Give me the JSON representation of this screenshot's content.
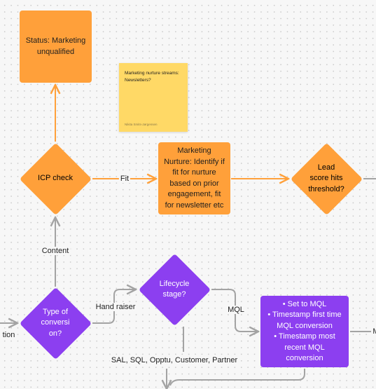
{
  "colors": {
    "orange": "#ffa03a",
    "purple": "#8c3ff0",
    "sticky": "#ffd966",
    "connector_grey": "#a3a3a3"
  },
  "nodes": {
    "status_unqualified": "Status: Marketing unqualified",
    "icp_check": "ICP check",
    "marketing_nurture": "Marketing Nurture: Identify if fit for nurture based on prior engagement, fit for newsletter etc",
    "lead_score": "Lead score hits threshold?",
    "type_of_conversion": "Type of conversi on?",
    "lifecycle_stage": "Lifecycle stage?",
    "mql_actions": [
      "Set to MQL",
      "Timestamp first time MQL conversion",
      "Timestamp most recent MQL conversion"
    ]
  },
  "sticky_note": {
    "text": "Marketing nurture streams: Newsletters?",
    "author": "Nikita Smits-Jørgensen"
  },
  "edge_labels": {
    "fit": "Fit",
    "content": "Content",
    "hand_raiser": "Hand raiser",
    "mql": "MQL",
    "other_stages": "SAL, SQL, Opptu, Customer, Partner",
    "left_cut": "tion",
    "right_cut": "M"
  }
}
